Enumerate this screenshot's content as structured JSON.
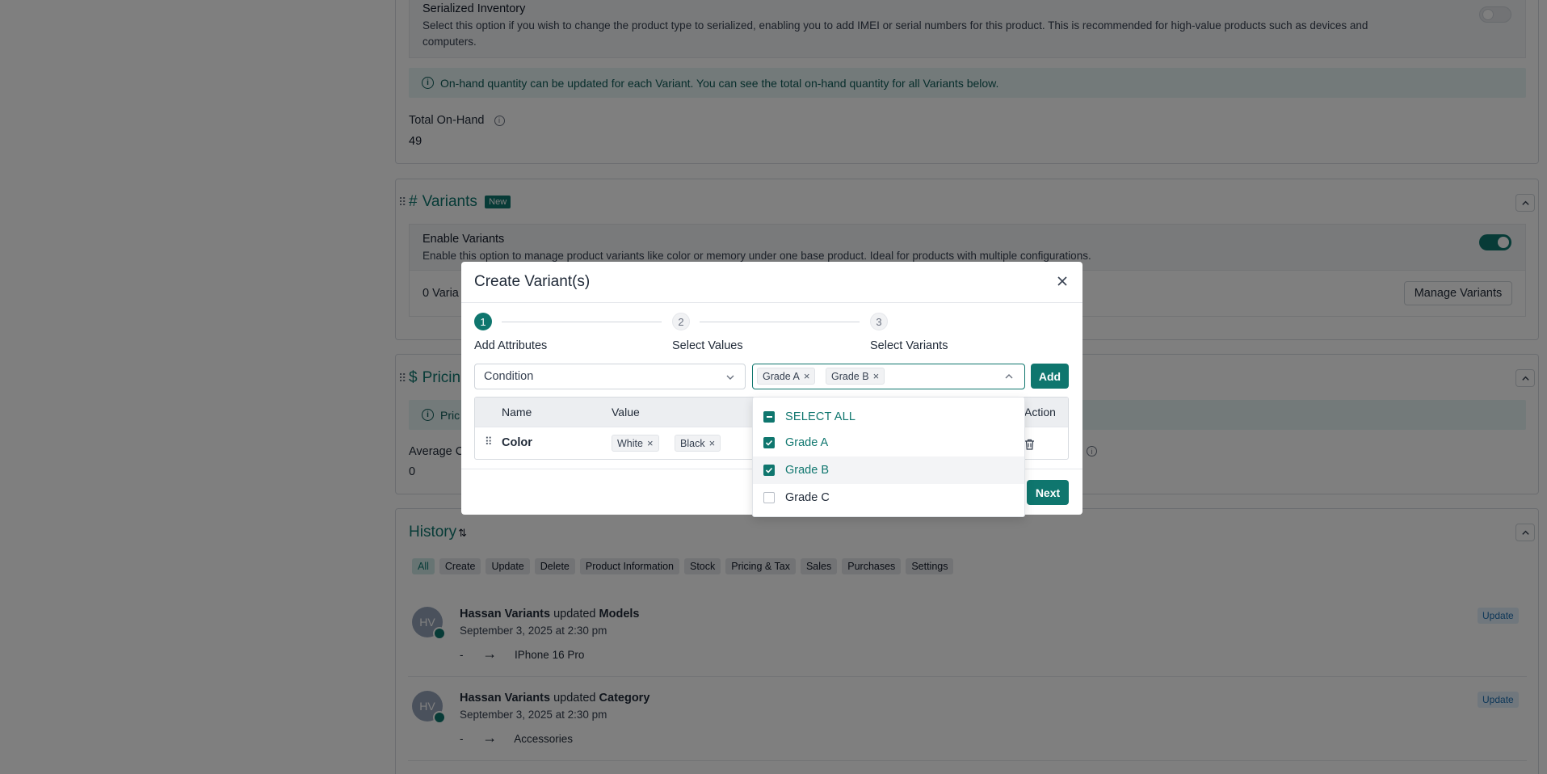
{
  "serialized": {
    "title": "Serialized Inventory",
    "desc_line1": "Select this option if you wish to change the product type to serialized, enabling you to add IMEI or serial numbers for this product. This is recommended for high-value products such as devices and",
    "desc_line2": "computers."
  },
  "onhand_info": "On-hand quantity can be updated for each Variant. You can see the total on-hand quantity for all Variants below.",
  "total_onhand": {
    "label": "Total On-Hand",
    "value": "49"
  },
  "variants_section": {
    "title": "Variants",
    "badge": "New",
    "enable_title": "Enable Variants",
    "enable_desc": "Enable this option to manage product variants like color or memory under one base product. Ideal for products with multiple configurations.",
    "count_text": "0 Varia",
    "manage_button": "Manage Variants"
  },
  "pricing_section": {
    "title": "Pricin",
    "info_text": "Pric",
    "avg_label": "Average C",
    "avg_value": "0"
  },
  "history": {
    "title": "History",
    "filters": [
      "All",
      "Create",
      "Update",
      "Delete",
      "Product Information",
      "Stock",
      "Pricing & Tax",
      "Sales",
      "Purchases",
      "Settings"
    ],
    "entries": [
      {
        "initials": "HV",
        "user": "Hassan Variants",
        "action": "updated",
        "field": "Models",
        "date": "September 3, 2025 at 2:30 pm",
        "from": "-",
        "to": "IPhone 16 Pro",
        "badge": "Update"
      },
      {
        "initials": "HV",
        "user": "Hassan Variants",
        "action": "updated",
        "field": "Category",
        "date": "September 3, 2025 at 2:30 pm",
        "from": "-",
        "to": "Accessories",
        "badge": "Update"
      }
    ]
  },
  "modal": {
    "title": "Create Variant(s)",
    "steps": [
      {
        "number": "1",
        "label": "Add Attributes"
      },
      {
        "number": "2",
        "label": "Select Values"
      },
      {
        "number": "3",
        "label": "Select Variants"
      }
    ],
    "attribute_select": "Condition",
    "selected_values": [
      "Grade A",
      "Grade B"
    ],
    "add_button": "Add",
    "table_headers": {
      "name": "Name",
      "value": "Value",
      "action": "Action"
    },
    "rows": [
      {
        "name": "Color",
        "values": [
          "White",
          "Black"
        ]
      }
    ],
    "next_button": "Next"
  },
  "dropdown": {
    "select_all": "SELECT ALL",
    "options": [
      {
        "label": "Grade A",
        "checked": true
      },
      {
        "label": "Grade B",
        "checked": true
      },
      {
        "label": "Grade C",
        "checked": false
      }
    ]
  },
  "colors": {
    "accent": "#0f766e",
    "info_bg": "#e6f4f4",
    "overlay": "rgba(0,0,0,0.5)"
  },
  "icons": [
    "info-icon",
    "close-icon",
    "chevron-down-icon",
    "chevron-up-icon",
    "trash-icon",
    "drag-handle-icon",
    "arrow-right-icon",
    "sort-icon"
  ]
}
